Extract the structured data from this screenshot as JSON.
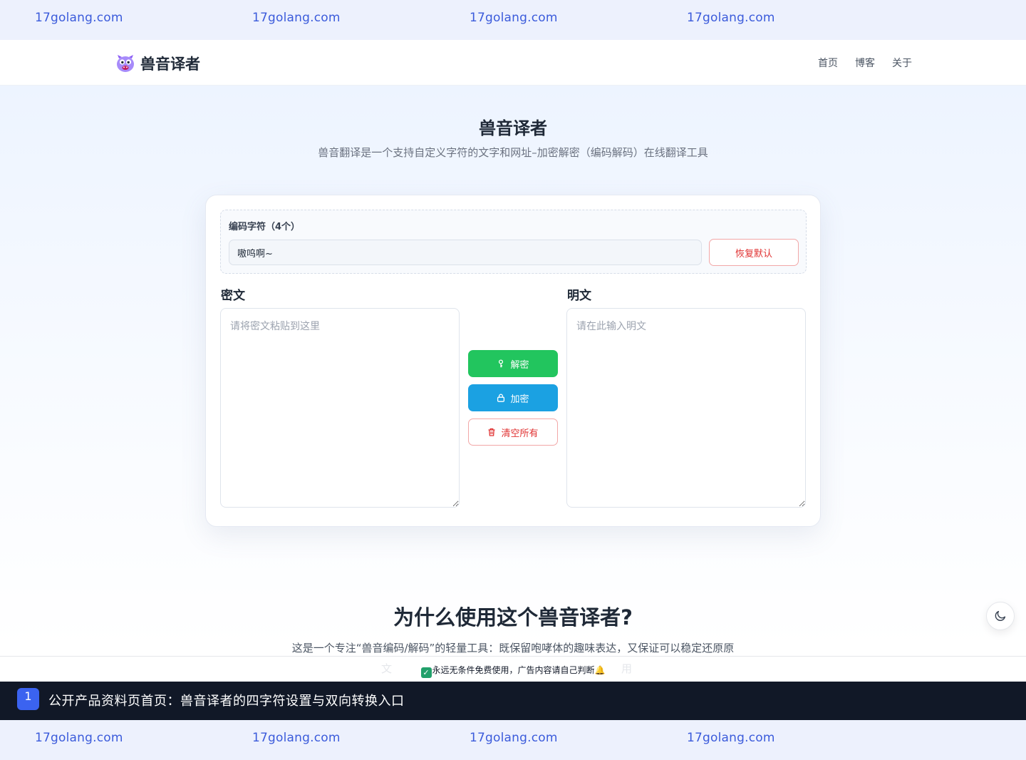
{
  "ads": {
    "top": [
      "17golang.com",
      "17golang.com",
      "17golang.com",
      "17golang.com"
    ],
    "bottom": [
      "17golang.com",
      "17golang.com",
      "17golang.com",
      "17golang.com"
    ]
  },
  "header": {
    "logo_text": "兽音译者",
    "nav": [
      "首页",
      "博客",
      "关于"
    ]
  },
  "hero": {
    "title": "兽音译者",
    "subtitle": "兽音翻译是一个支持自定义字符的文字和网址–加密解密（编码解码）在线翻译工具"
  },
  "tool": {
    "char_label": "编码字符（4个）",
    "char_value": "嗷呜啊~",
    "reset_label": "恢复默认",
    "cipher_label": "密文",
    "cipher_placeholder": "请将密文粘贴到这里",
    "plain_label": "明文",
    "plain_placeholder": "请在此输入明文",
    "decode_label": "解密",
    "encode_label": "加密",
    "clear_label": "清空所有"
  },
  "why": {
    "title": "为什么使用这个兽音译者?",
    "subtitle": "这是一个专注“兽音编码/解码”的轻量工具：既保留咆哮体的趣味表达，又保证可以稳定还原原"
  },
  "notice": {
    "ghost_left": "文",
    "ghost_right": "用",
    "text": "永远无条件免费使用，广告内容请自己判断"
  },
  "step": {
    "number": "1",
    "text": "公开产品资料页首页：兽音译者的四字符设置与双向转换入口"
  },
  "colors": {
    "decode": "#22c55e",
    "encode": "#1ba1e2",
    "danger": "#e03131",
    "step_bar": "#111827",
    "ad_bg": "#edf1fd"
  },
  "icons": {
    "logo": "monster-face-icon",
    "decode": "key-icon",
    "encode": "lock-icon",
    "clear": "trash-icon",
    "theme": "moon-icon"
  }
}
